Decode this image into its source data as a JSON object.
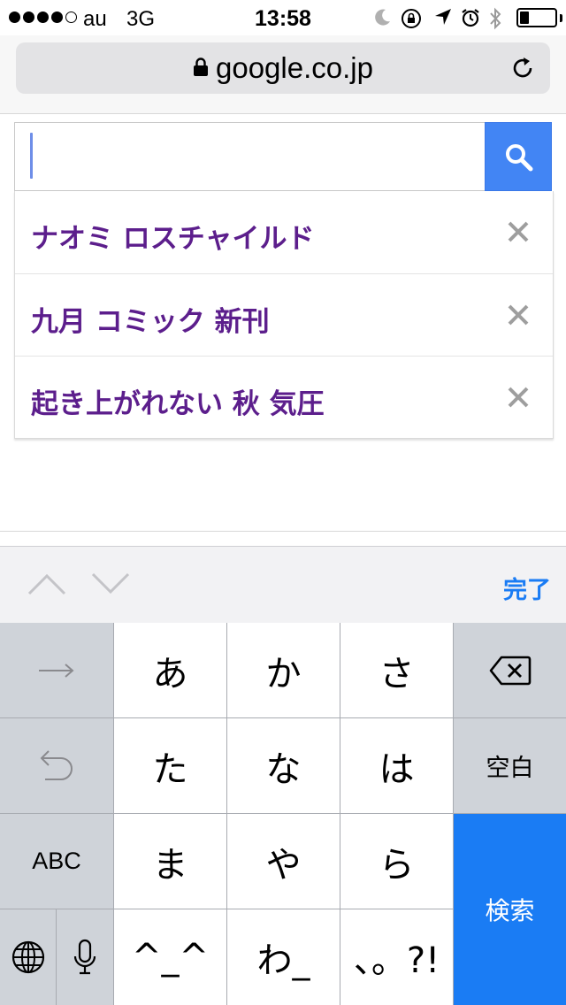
{
  "status_bar": {
    "carrier": "au",
    "network": "3G",
    "time": "13:58",
    "signal_bars_filled": 4,
    "signal_bars_total": 5,
    "battery_level": 0.2
  },
  "address_bar": {
    "url": "google.co.jp",
    "lock_icon": "lock-icon",
    "reload_icon": "reload-icon"
  },
  "search": {
    "value": "",
    "button_icon": "search-icon",
    "accent_color": "#4285f4"
  },
  "suggestions": [
    {
      "text": "ナオミ ロスチャイルド",
      "remove_icon": "close-icon"
    },
    {
      "text": "九月 コミック 新刊",
      "remove_icon": "close-icon"
    },
    {
      "text": "起き上がれない 秋 気圧",
      "remove_icon": "close-icon"
    }
  ],
  "accessory": {
    "done_label": "完了",
    "prev_icon": "chevron-up-icon",
    "next_icon": "chevron-down-icon"
  },
  "keyboard": {
    "keys": {
      "a": "あ",
      "ka": "か",
      "sa": "さ",
      "ta": "た",
      "na": "な",
      "ha": "は",
      "ma": "ま",
      "ya": "や",
      "ra": "ら",
      "kaomoji": "^_^",
      "wa": "わ_",
      "punct": "、。?!",
      "abc": "ABC",
      "space": "空白",
      "search": "検索"
    },
    "search_key_color": "#1a7cf4"
  }
}
